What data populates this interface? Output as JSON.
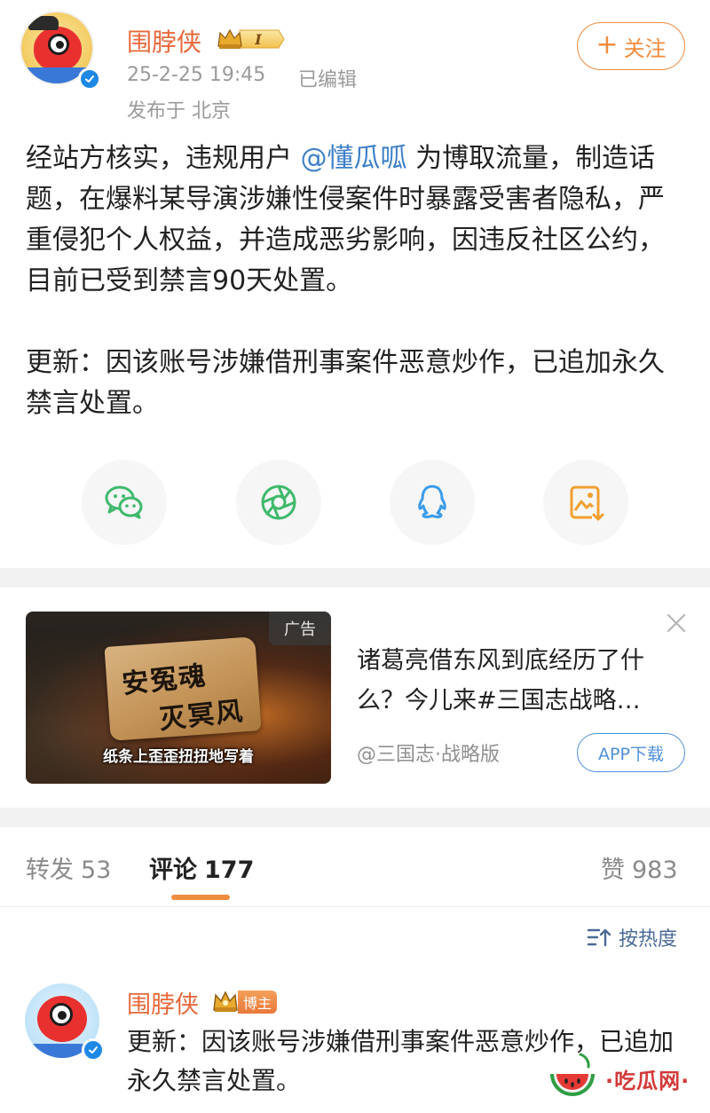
{
  "post": {
    "username": "围脖侠",
    "vip_level": "I",
    "time": "25-2-25 19:45",
    "edited": "已编辑",
    "location": "发布于 北京",
    "follow_label": "关注",
    "body": {
      "p1_before": "经站方核实，违规用户 ",
      "p1_mention": "@懂瓜呱",
      "p1_after": " 为博取流量，制造话题，在爆料某导演涉嫌性侵案件时暴露受害者隐私，严重侵犯个人权益，并造成恶劣影响，因违反社区公约，目前已受到禁言90天处置。",
      "p2": "更新：因该账号涉嫌借刑事案件恶意炒作，已追加永久禁言处置。"
    },
    "share": [
      {
        "icon": "wechat-icon",
        "color": "#3fb96b"
      },
      {
        "icon": "moments-icon",
        "color": "#3fb96b"
      },
      {
        "icon": "qq-icon",
        "color": "#3a9be8"
      },
      {
        "icon": "save-image-icon",
        "color": "#f0a030"
      }
    ]
  },
  "ad": {
    "tag": "广告",
    "image_title_line1": "安冤魂",
    "image_title_line2": "灭冥风",
    "image_caption": "纸条上歪歪扭扭地写着",
    "title": "诸葛亮借东风到底经历了什么？今儿来#三国志战略…",
    "source": "@三国志·战略版",
    "cta": "APP下载"
  },
  "tabs": {
    "repost": {
      "label": "转发",
      "count": "53"
    },
    "comment": {
      "label": "评论",
      "count": "177"
    },
    "like": {
      "label": "赞",
      "count": "983"
    }
  },
  "sort": {
    "label": "按热度"
  },
  "comment": {
    "username": "围脖侠",
    "badge": "博主",
    "text": "更新：因该账号涉嫌借刑事案件恶意炒作，已追加永久禁言处置。"
  },
  "watermark": {
    "text": "·吃瓜网·"
  },
  "colors": {
    "accent_orange": "#f08c3e",
    "username": "#e8683a",
    "mention": "#3d7fc7",
    "link_blue": "#4f8fd7"
  }
}
